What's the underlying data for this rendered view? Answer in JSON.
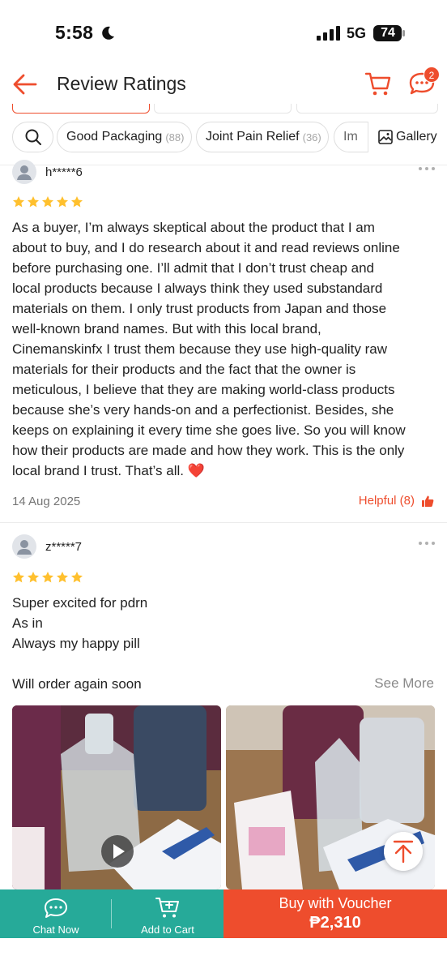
{
  "status_bar": {
    "time": "5:58",
    "network": "5G",
    "battery": "74"
  },
  "header": {
    "title": "Review Ratings",
    "chat_badge": "2"
  },
  "filters": [
    {
      "label": "Good Packaging",
      "count": "(88)"
    },
    {
      "label": "Joint Pain Relief",
      "count": "(36)"
    },
    {
      "label": "Im",
      "count": ""
    }
  ],
  "gallery_label": "Gallery",
  "reviews": [
    {
      "username": "h*****6",
      "rating": 5,
      "text_lines": [
        "As a buyer, I’m always skeptical about the product that I am",
        "about to buy, and I do research about it and read reviews online",
        "before purchasing one. I’ll admit that I don’t trust cheap and",
        "local products because I always think they used substandard",
        "materials on them. I only trust products from Japan and those",
        "well-known brand names. But with this local brand,",
        "Cinemanskinfx I trust them because they use high-quality raw",
        "materials for their products and the fact that the owner is",
        "meticulous, I believe that they are making world-class products",
        "because she’s very hands-on and a perfectionist. Besides, she",
        "keeps on explaining it every time she goes live. So you will know",
        "how their products are made and how they work. This is the only",
        "local brand I trust. That’s all. ❤️"
      ],
      "date": "14 Aug 2025",
      "helpful": "Helpful (8)"
    },
    {
      "username": "z*****7",
      "rating": 5,
      "text_lines": [
        "Super excited for pdrn",
        "As in",
        "Always my happy pill",
        "",
        "Will order again soon"
      ],
      "see_more": "See More"
    }
  ],
  "bottom_bar": {
    "chat_label": "Chat Now",
    "cart_label": "Add to Cart",
    "buy_label": "Buy with Voucher",
    "buy_price": "₱2,310"
  },
  "colors": {
    "brand": "#ee4d2d",
    "teal": "#26aa99",
    "star": "#ffc02e"
  },
  "icons": [
    "back-arrow-icon",
    "cart-icon",
    "chat-icon",
    "search-icon",
    "gallery-icon",
    "more-icon",
    "star-icon",
    "thumbs-up-icon",
    "play-icon",
    "arrow-up-icon"
  ]
}
